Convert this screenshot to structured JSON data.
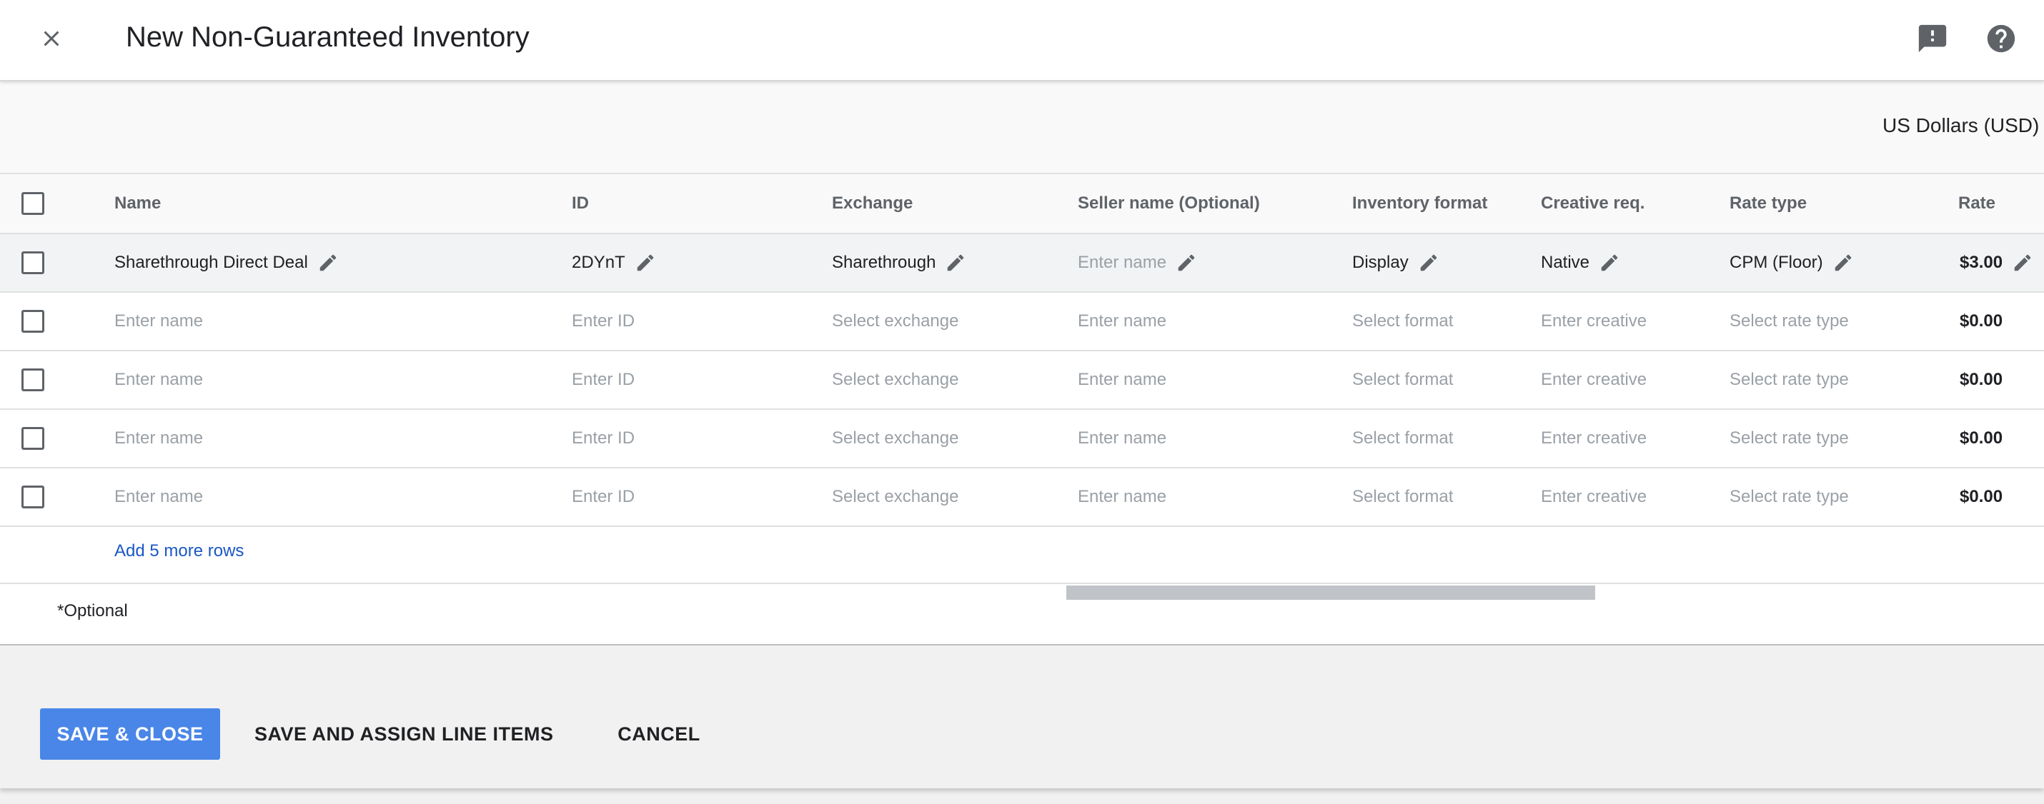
{
  "header": {
    "title": "New Non-Guaranteed Inventory",
    "close_icon": "close-icon",
    "feedback_icon": "feedback-icon",
    "help_icon": "help-icon"
  },
  "toolbar": {
    "currency": "US Dollars (USD)"
  },
  "table": {
    "columns": {
      "name": "Name",
      "id": "ID",
      "exchange": "Exchange",
      "seller": "Seller name (Optional)",
      "format": "Inventory format",
      "creative": "Creative req.",
      "rate_type": "Rate type",
      "rate": "Rate"
    },
    "filled_row": {
      "name": "Sharethrough Direct Deal",
      "id": "2DYnT",
      "exchange": "Sharethrough",
      "seller": "Enter name",
      "format": "Display",
      "creative": "Native",
      "rate_type": "CPM (Floor)",
      "rate": "$3.00"
    },
    "empty_rows": [
      {
        "name": "Enter name",
        "id": "Enter ID",
        "exchange": "Select exchange",
        "seller": "Enter name",
        "format": "Select format",
        "creative": "Enter creative",
        "rate_type": "Select rate type",
        "rate": "$0.00"
      },
      {
        "name": "Enter name",
        "id": "Enter ID",
        "exchange": "Select exchange",
        "seller": "Enter name",
        "format": "Select format",
        "creative": "Enter creative",
        "rate_type": "Select rate type",
        "rate": "$0.00"
      },
      {
        "name": "Enter name",
        "id": "Enter ID",
        "exchange": "Select exchange",
        "seller": "Enter name",
        "format": "Select format",
        "creative": "Enter creative",
        "rate_type": "Select rate type",
        "rate": "$0.00"
      },
      {
        "name": "Enter name",
        "id": "Enter ID",
        "exchange": "Select exchange",
        "seller": "Enter name",
        "format": "Select format",
        "creative": "Enter creative",
        "rate_type": "Select rate type",
        "rate": "$0.00"
      }
    ],
    "add_rows_label": "Add 5 more rows",
    "optional_note": "*Optional"
  },
  "footer": {
    "save_close": "SAVE & CLOSE",
    "save_assign": "SAVE AND ASSIGN LINE ITEMS",
    "cancel": "CANCEL"
  },
  "colors": {
    "primary": "#4a86e8",
    "link": "#1a57c5",
    "placeholder": "#9aa0a6"
  }
}
